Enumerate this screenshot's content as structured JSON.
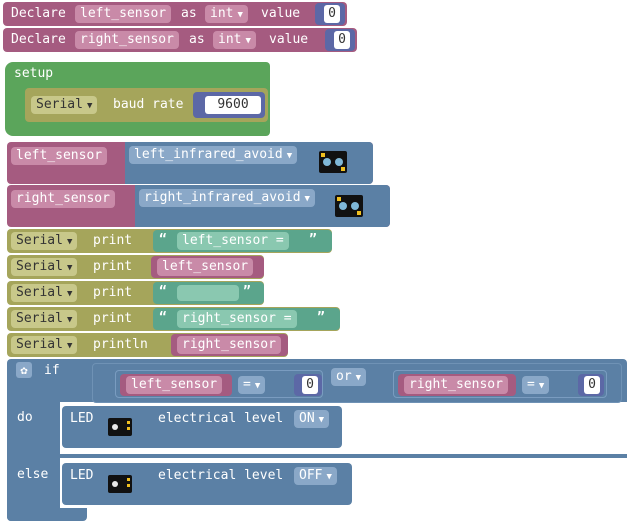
{
  "colors": {
    "var_block": "#a55b80",
    "var_block_dark": "#8a4a6b",
    "math_num": "#5c68a6",
    "setup": "#5ba55b",
    "serial": "#a5a55b",
    "sensor": "#5b80a5",
    "text": "#5ba58c",
    "logic": "#5b80a5",
    "led": "#5b80a5"
  },
  "declares": [
    {
      "keyword": "Declare",
      "name": "left_sensor",
      "as": "as",
      "type": "int",
      "value_label": "value",
      "value": "0"
    },
    {
      "keyword": "Declare",
      "name": "right_sensor",
      "as": "as",
      "type": "int",
      "value_label": "value",
      "value": "0"
    }
  ],
  "setup": {
    "label": "setup",
    "serial": "Serial",
    "baud_label": "baud rate",
    "baud": "9600"
  },
  "assigns": [
    {
      "var": "left_sensor",
      "sensor": "left_infrared_avoid",
      "sensor_icon": "infrared-sensor-icon"
    },
    {
      "var": "right_sensor",
      "sensor": "right_infrared_avoid",
      "sensor_icon": "infrared-sensor-icon"
    }
  ],
  "prints": [
    {
      "serial": "Serial",
      "cmd": "print",
      "kind": "text",
      "value": "left_sensor ="
    },
    {
      "serial": "Serial",
      "cmd": "print",
      "kind": "var",
      "value": "left_sensor"
    },
    {
      "serial": "Serial",
      "cmd": "print",
      "kind": "text",
      "value": ""
    },
    {
      "serial": "Serial",
      "cmd": "print",
      "kind": "text",
      "value": "right_sensor ="
    },
    {
      "serial": "Serial",
      "cmd": "println",
      "kind": "var",
      "value": "right_sensor"
    }
  ],
  "quote_open": "“",
  "quote_close": "”",
  "ifblock": {
    "if_label": "if",
    "do_label": "do",
    "else_label": "else",
    "left": {
      "var": "left_sensor",
      "op": "=",
      "value": "0"
    },
    "logic_op": "or",
    "right": {
      "var": "right_sensor",
      "op": "=",
      "value": "0"
    },
    "gear_icon": "gear-icon"
  },
  "leds": [
    {
      "label": "LED",
      "icon": "led-module-icon",
      "level_label": "electrical level",
      "level": "ON"
    },
    {
      "label": "LED",
      "icon": "led-module-icon",
      "level_label": "electrical level",
      "level": "OFF"
    }
  ]
}
